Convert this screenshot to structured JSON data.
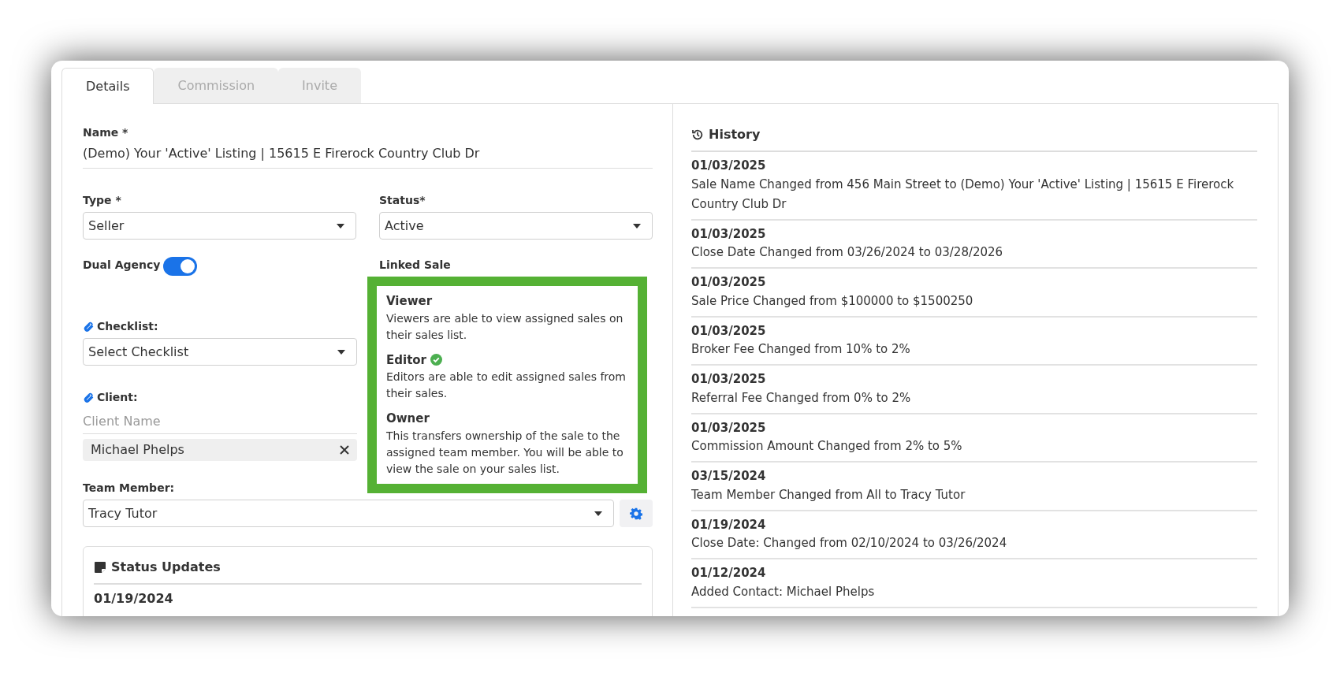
{
  "tabs": [
    {
      "label": "Details",
      "selected": true
    },
    {
      "label": "Commission",
      "selected": false
    },
    {
      "label": "Invite",
      "selected": false
    }
  ],
  "form": {
    "name": {
      "label": "Name *",
      "value": "(Demo) Your 'Active' Listing | 15615 E Firerock Country Club Dr"
    },
    "type": {
      "label": "Type *",
      "value": "Seller"
    },
    "status": {
      "label": "Status*",
      "value": "Active"
    },
    "dual_agency": {
      "label": "Dual Agency",
      "on": true
    },
    "linked_sale": {
      "label": "Linked Sale"
    },
    "checklist": {
      "label": "Checklist:",
      "value": "Select Checklist"
    },
    "client": {
      "label": "Client:",
      "placeholder": "Client Name",
      "chips": [
        "Michael Phelps"
      ]
    },
    "team_member": {
      "label": "Team Member:",
      "value": "Tracy Tutor"
    }
  },
  "role_tooltip": {
    "roles": [
      {
        "title": "Viewer",
        "description": "Viewers are able to view assigned sales on their sales list.",
        "checked": false
      },
      {
        "title": "Editor",
        "description": "Editors are able to edit assigned sales from their sales.",
        "checked": true
      },
      {
        "title": "Owner",
        "description": "This transfers ownership of the sale to the assigned team member. You will be able to view the sale on your sales list.",
        "checked": false
      }
    ]
  },
  "status_updates": {
    "title": "Status Updates",
    "entries": [
      {
        "date": "01/19/2024"
      }
    ]
  },
  "history": {
    "title": "History",
    "entries": [
      {
        "date": "01/03/2025",
        "text": "Sale Name Changed from 456 Main Street to (Demo) Your 'Active' Listing | 15615 E Firerock Country Club Dr"
      },
      {
        "date": "01/03/2025",
        "text": "Close Date Changed from 03/26/2024 to 03/28/2026"
      },
      {
        "date": "01/03/2025",
        "text": "Sale Price Changed from $100000 to $1500250"
      },
      {
        "date": "01/03/2025",
        "text": "Broker Fee Changed from 10% to 2%"
      },
      {
        "date": "01/03/2025",
        "text": "Referral Fee Changed from 0% to 2%"
      },
      {
        "date": "01/03/2025",
        "text": "Commission Amount Changed from 2% to 5%"
      },
      {
        "date": "03/15/2024",
        "text": "Team Member Changed from All to Tracy Tutor"
      },
      {
        "date": "01/19/2024",
        "text": "Close Date: Changed from 02/10/2024 to 03/26/2024"
      },
      {
        "date": "01/12/2024",
        "text": "Added Contact: Michael Phelps"
      }
    ]
  }
}
